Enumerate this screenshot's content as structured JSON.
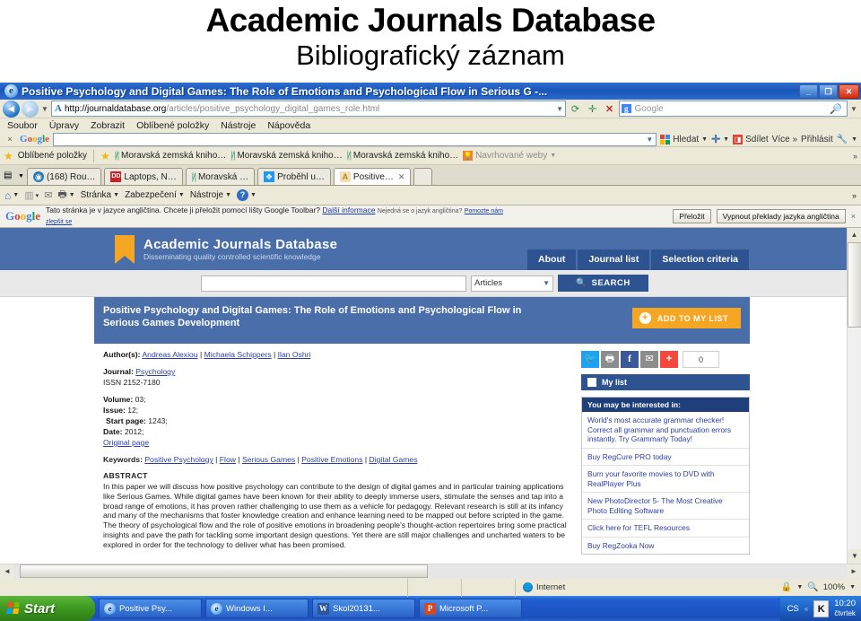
{
  "slide": {
    "title": "Academic Journals Database",
    "subtitle": "Bibliografický záznam"
  },
  "browser": {
    "window_title": "Positive Psychology and Digital Games: The Role of Emotions and Psychological Flow in Serious G -...",
    "window_buttons": {
      "minimize": "_",
      "maximize": "❐",
      "close": "✕"
    },
    "address": {
      "protocol_host": "http://journaldatabase.org",
      "path": "/articles/positive_psychology_digital_games_role.html",
      "favicon": "A",
      "refresh_icon": "refresh-icon",
      "stop_icon": "✕",
      "search_placeholder": "Google",
      "search_mark": "g"
    },
    "menu": [
      "Soubor",
      "Úpravy",
      "Zobrazit",
      "Oblíbené položky",
      "Nástroje",
      "Nápověda"
    ],
    "google_toolbar": {
      "close": "×",
      "logo": "Google",
      "query": "",
      "search_label": "Hledat",
      "share_label": "Sdílet",
      "more_label": "Více »",
      "signin_label": "Přihlásit"
    },
    "favorites_bar": {
      "label": "Oblíbené položky",
      "items": [
        "Moravská zemská kniho…",
        "Moravská zemská kniho…",
        "Moravská zemská kniho…"
      ],
      "suggested_sites": "Navrhované weby",
      "overflow": "»"
    },
    "tabs": [
      {
        "label": "(168) Rou…",
        "icon": "rou",
        "active": false
      },
      {
        "label": "Laptops, N…",
        "icon": "dd",
        "active": false
      },
      {
        "label": "Moravská …",
        "icon": "mzk",
        "active": false
      },
      {
        "label": "Proběhl u…",
        "icon": "win",
        "active": false
      },
      {
        "label": "Positive…",
        "icon": "pos",
        "active": true
      }
    ],
    "command_bar": {
      "home": "Domovská stránka",
      "feeds": "Kanály",
      "mail": "Pošta",
      "print": "Tisk",
      "page": "Stránka",
      "security": "Zabezpečení",
      "tools": "Nástroje",
      "help": "?",
      "overflow": "»"
    },
    "translate_bar": {
      "logo": "Google",
      "message_main": "Tato stránka je v jazyce angličtina. Chcete ji přeložit pomocí lišty Google Toolbar?",
      "more_info": "Další informace",
      "not_english": "Nejedná se o jazyk angličtina?",
      "help_us": "Pomozte nám",
      "improve": "zlepšit se",
      "translate_button": "Přeložit",
      "disable_button": "Vypnout překlady jazyka angličtina",
      "close": "×"
    },
    "status_bar": {
      "zone": "Internet",
      "zoom": "100%",
      "lock_icon": "lock-icon"
    },
    "scrollbars": {
      "up": "▲",
      "down": "▼",
      "left": "◄",
      "right": "►"
    }
  },
  "site": {
    "name": "Academic Journals Database",
    "tagline": "Disseminating quality controlled scientific knowledge",
    "nav": [
      "About",
      "Journal list",
      "Selection criteria"
    ],
    "search": {
      "query": "",
      "scope": "Articles",
      "button": "SEARCH",
      "icon": "search-icon"
    }
  },
  "article": {
    "title": "Positive Psychology and Digital Games: The Role of Emotions and Psychological Flow in Serious Games Development",
    "add_button": "ADD TO MY LIST",
    "authors_label": "Author(s):",
    "authors": [
      "Andreas Alexiou",
      "Michaela Schippers",
      "Ilan Oshri"
    ],
    "journal_label": "Journal:",
    "journal": "Psychology",
    "issn": "ISSN 2152-7180",
    "volume_label": "Volume:",
    "volume": "03;",
    "issue_label": "Issue:",
    "issue": "12;",
    "start_page_label": "Start page:",
    "start_page": "1243;",
    "date_label": "Date:",
    "date": "2012;",
    "original_page": "Original page",
    "keywords_label": "Keywords:",
    "keywords": [
      "Positive Psychology",
      "Flow",
      "Serious Games",
      "Positive Emotions",
      "Digital Games"
    ],
    "abstract_heading": "ABSTRACT",
    "abstract": "In this paper we will discuss how positive psychology can contribute to the design of digital games and in particular training applications like Serious Games. While digital games have been known for their ability to deeply immerse users, stimulate the senses and tap into a broad range of emotions, it has proven rather challenging to use them as a vehicle for pedagogy. Relevant research is still at its infancy and many of the mechanisms that foster knowledge creation and enhance learning need to be mapped out before scripted in the game. The theory of psychological flow and the role of positive emotions in broadening people's thought-action repertoires bring some practical insights and pave the path for tackling some important design questions. Yet there are still major challenges and uncharted waters to be explored in order for the technology to deliver what has been promised."
  },
  "sidebar": {
    "social": [
      {
        "name": "twitter-share",
        "glyph": "🐦"
      },
      {
        "name": "print-share",
        "glyph": "🖶"
      },
      {
        "name": "facebook-share",
        "glyph": "f"
      },
      {
        "name": "email-share",
        "glyph": "✉"
      },
      {
        "name": "more-share",
        "glyph": "+"
      }
    ],
    "share_count": "0",
    "my_list": "My list",
    "interest_heading": "You may be interested in:",
    "ads": [
      "World's most accurate grammar checker! Correct all grammar and punctuation errors instantly. Try Grammarly Today!",
      "Buy RegCure PRO today",
      "Burn your favorite movies to DVD with RealPlayer Plus",
      "New PhotoDirector 5- The Most Creative Photo Editing Software",
      "Click here for TEFL Resources",
      "Buy RegZooka Now"
    ]
  },
  "taskbar": {
    "start": "Start",
    "items": [
      {
        "label": "Positive Psy...",
        "icon": "ie"
      },
      {
        "label": "Windows I...",
        "icon": "ie"
      },
      {
        "label": "Skol20131...",
        "icon": "word"
      },
      {
        "label": "Microsoft P...",
        "icon": "powerpoint"
      }
    ],
    "language": "CS",
    "tray_icon": "K",
    "time": "10:20",
    "day": "čtvrtek"
  },
  "colors": {
    "site_header": "#4a6ea9",
    "site_nav": "#2e5391",
    "accent_orange": "#f5a623",
    "link": "#2a3fa0",
    "title_bar": "#1a56b8"
  }
}
